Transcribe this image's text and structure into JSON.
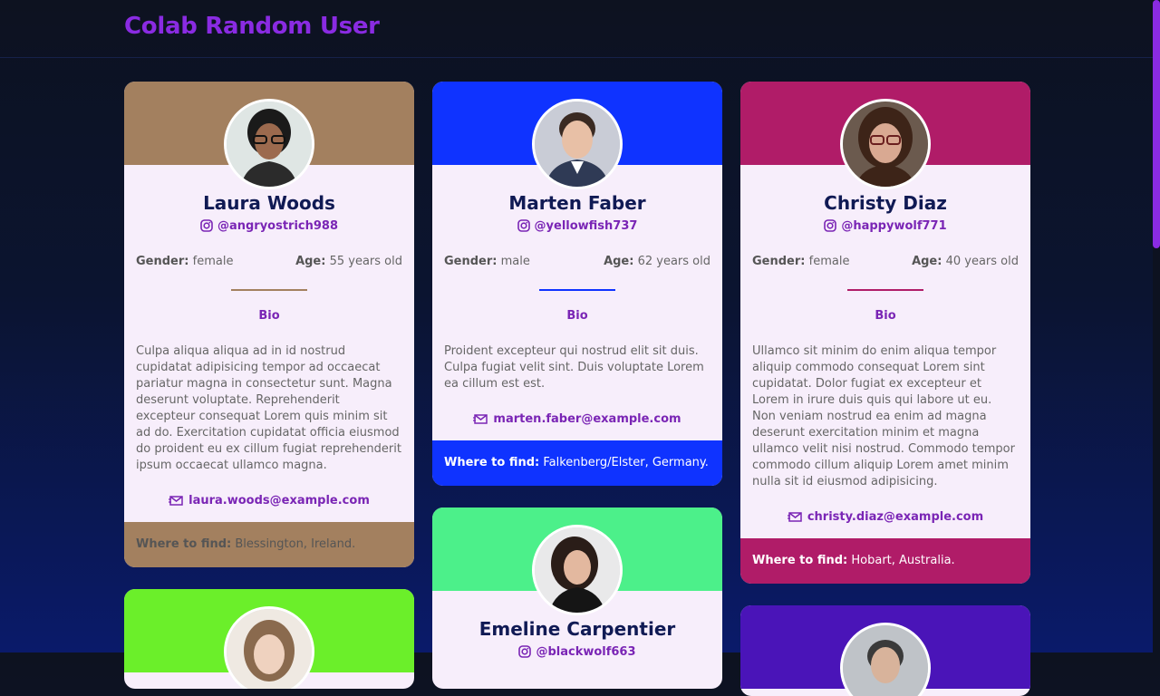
{
  "app": {
    "title": "Colab Random User"
  },
  "labels": {
    "gender": "Gender:",
    "age": "Age:",
    "bio": "Bio",
    "where": "Where to find:"
  },
  "cards": [
    {
      "name": "Laura Woods",
      "handle": "@angryostrich988",
      "gender": "female",
      "age": "55 years old",
      "bio": "Culpa aliqua aliqua ad in id nostrud cupidatat adipisicing tempor ad occaecat pariatur magna in consectetur sunt. Magna deserunt voluptate. Reprehenderit excepteur consequat Lorem quis minim sit ad do. Exercitation cupidatat officia eiusmod do proident eu ex cillum fugiat reprehenderit ipsum occaecat ullamco magna.",
      "email": "laura.woods@example.com",
      "location": "Blessington, Ireland.",
      "color": "#a3805f"
    },
    {
      "name": "Marten Faber",
      "handle": "@yellowfish737",
      "gender": "male",
      "age": "62 years old",
      "bio": "Proident excepteur qui nostrud elit sit duis. Culpa fugiat velit sint. Duis voluptate Lorem ea cillum est est.",
      "email": "marten.faber@example.com",
      "location": "Falkenberg/Elster, Germany.",
      "color": "#0f33ff"
    },
    {
      "name": "Christy Diaz",
      "handle": "@happywolf771",
      "gender": "female",
      "age": "40 years old",
      "bio": "Ullamco sit minim do enim aliqua tempor aliquip commodo consequat Lorem sint cupidatat. Dolor fugiat ex excepteur et Lorem in irure duis quis qui labore ut eu. Non veniam nostrud ea enim ad magna deserunt exercitation minim et magna ullamco velit nisi nostrud. Commodo tempor commodo cillum aliquip Lorem amet minim nulla sit id eiusmod adipisicing.",
      "email": "christy.diaz@example.com",
      "location": "Hobart, Australia.",
      "color": "#b01c68"
    },
    {
      "name": "Emeline Carpentier",
      "handle": "@blackwolf663",
      "color": "#4cf08a"
    }
  ],
  "partial_cards": [
    {
      "color": "#6bef2a"
    },
    {
      "color": "#4a14b8"
    }
  ]
}
